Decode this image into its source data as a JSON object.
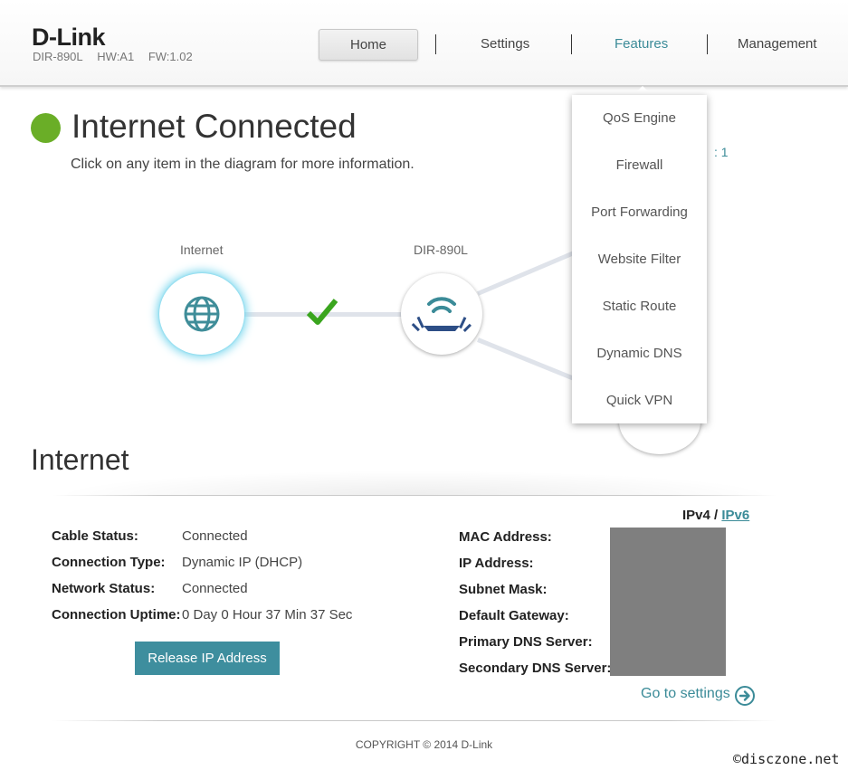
{
  "header": {
    "brand": "D-Link",
    "model": "DIR-890L",
    "hw": "HW:A1",
    "fw": "FW:1.02",
    "nav": [
      "Home",
      "Settings",
      "Features",
      "Management"
    ]
  },
  "status": {
    "title": "Internet Connected",
    "subtitle": "Click on any item in the diagram for more information.",
    "indicator_color": "#6aae27",
    "clients_tail": ": 1"
  },
  "diagram": {
    "internet_label": "Internet",
    "router_label": "DIR-890L",
    "link_status": "connected"
  },
  "features_menu": {
    "items": [
      "QoS Engine",
      "Firewall",
      "Port Forwarding",
      "Website Filter",
      "Static Route",
      "Dynamic DNS",
      "Quick VPN"
    ]
  },
  "internet": {
    "title": "Internet",
    "ipv4": "IPv4",
    "sep": "/",
    "ipv6": "IPv6",
    "left": [
      {
        "label": "Cable Status:",
        "value": "Connected"
      },
      {
        "label": "Connection Type:",
        "value": "Dynamic IP (DHCP)"
      },
      {
        "label": "Network Status:",
        "value": "Connected"
      },
      {
        "label": "Connection Uptime:",
        "value": "0 Day 0 Hour 37 Min 37 Sec"
      }
    ],
    "right": [
      {
        "label": "MAC Address:"
      },
      {
        "label": "IP Address:"
      },
      {
        "label": "Subnet Mask:"
      },
      {
        "label": "Default Gateway:"
      },
      {
        "label": "Primary DNS Server:"
      },
      {
        "label": "Secondary DNS Server:"
      }
    ],
    "release_button": "Release IP Address",
    "goto_settings": "Go to settings"
  },
  "footer": {
    "copyright": "COPYRIGHT © 2014 D-Link",
    "watermark": "©disczone.net"
  },
  "colors": {
    "accent": "#3b8b98",
    "button": "#3e8e9e",
    "redaction": "#7f7f7f"
  }
}
